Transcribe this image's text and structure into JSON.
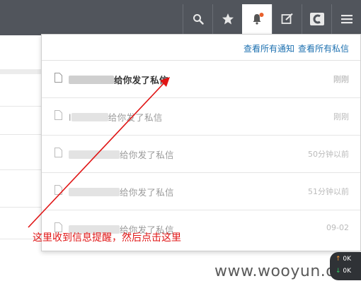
{
  "header": {
    "icons": [
      "search-icon",
      "star-icon",
      "bell-icon",
      "edit-icon",
      "app-logo-icon",
      "menu-icon"
    ],
    "badge_color": "#e8602c"
  },
  "dropdown": {
    "links": [
      "查看所有通知",
      "查看所有私信"
    ],
    "items": [
      {
        "sender_visible": "",
        "message": "给你发了私信",
        "time": "刚刚",
        "unread": true
      },
      {
        "sender_visible": "l",
        "message": "给你发了私信",
        "time": "刚刚",
        "unread": false
      },
      {
        "sender_visible": "",
        "message": "给你发了私信",
        "time": "50分钟以前",
        "unread": false
      },
      {
        "sender_visible": "",
        "message": "给你发了私信",
        "time": "51分钟以前",
        "unread": false
      },
      {
        "sender_visible": "",
        "message": "给你发了私信",
        "time": "09-02",
        "unread": false
      }
    ]
  },
  "annotation": {
    "text": "这里收到信息提醒，然后点击这里",
    "color": "#e01515"
  },
  "watermark": "www.wooyun.org",
  "speed_widget": {
    "up": "0K",
    "down": "0K"
  }
}
